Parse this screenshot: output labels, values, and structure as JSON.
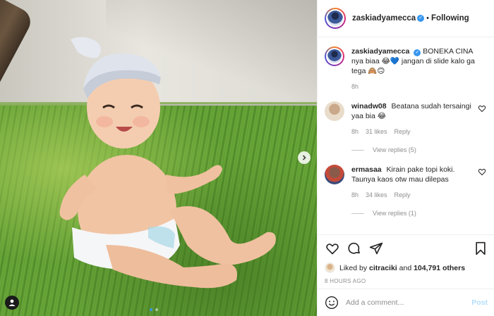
{
  "post": {
    "author": "zaskiadyamecca",
    "separator": "•",
    "follow_status": "Following",
    "caption_user": "zaskiadyamecca",
    "caption_text": "BONEKA CINA nya biaa 😂💙 jangan di slide kalo ga tega 🙈🙃",
    "caption_time": "8h",
    "likes_prefix": "Liked by ",
    "likes_user": "citraciki",
    "likes_and": " and ",
    "likes_count": "104,791 others",
    "timestamp": "8 HOURS AGO",
    "add_comment_placeholder": "Add a comment...",
    "post_label": "Post"
  },
  "comments": [
    {
      "user": "winadw08",
      "text": "Beatana sudah tersaingi yaa bia 😂",
      "time": "8h",
      "likes": "31 likes",
      "reply": "Reply",
      "view_replies": "View replies (5)"
    },
    {
      "user": "ermasaa",
      "text": "Kirain pake topi koki. Taunya kaos otw mau dilepas",
      "time": "8h",
      "likes": "34 likes",
      "reply": "Reply",
      "view_replies": "View replies (1)"
    }
  ],
  "icons": {
    "like": "heart-icon",
    "comment": "comment-icon",
    "share": "share-icon",
    "save": "bookmark-icon",
    "next": "chevron-right-icon",
    "tag": "user-tag-icon",
    "emoji": "emoji-icon",
    "verified": "verified-badge-icon"
  },
  "carousel": {
    "slides": 2,
    "active": 1
  },
  "colors": {
    "verified": "#3897f0",
    "post_disabled": "#b2dffc",
    "muted": "#8e8e8e",
    "text": "#262626"
  }
}
